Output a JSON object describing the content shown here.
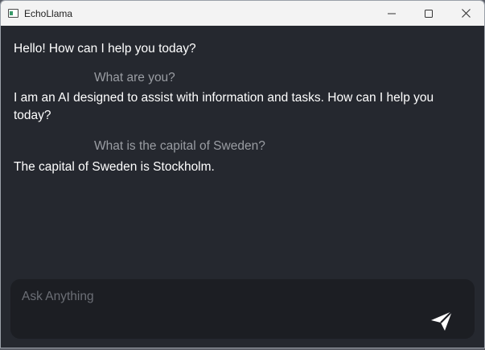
{
  "window": {
    "title": "EchoLlama",
    "controls": [
      "minimize-icon",
      "maximize-icon",
      "close-icon"
    ]
  },
  "chat": {
    "messages": [
      {
        "role": "assistant",
        "text": "Hello! How can I help you today?"
      },
      {
        "role": "user",
        "text": "What are you?"
      },
      {
        "role": "assistant",
        "text": "I am an AI designed to assist with information and tasks. How can I help you today?"
      },
      {
        "role": "user",
        "text": "What is the capital of Sweden?"
      },
      {
        "role": "assistant",
        "text": "The capital of Sweden is Stockholm."
      }
    ]
  },
  "composer": {
    "placeholder": "Ask Anything",
    "value": "",
    "send_icon": "send-icon"
  },
  "colors": {
    "background": "#25282f",
    "input_background": "#1c1e23",
    "assistant_text": "#ffffff",
    "user_text": "#9a9da3",
    "titlebar": "#f3f3f3"
  }
}
